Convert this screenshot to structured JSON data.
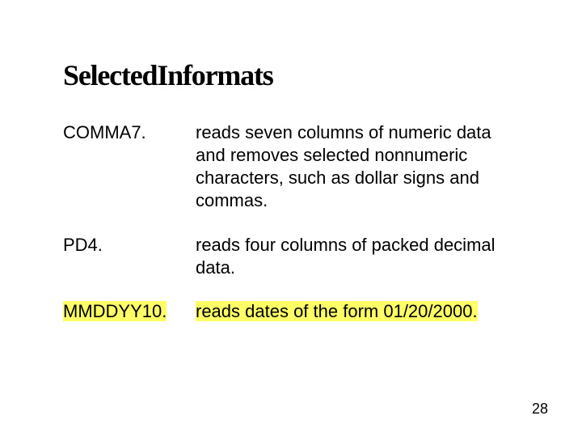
{
  "title_part1": "Selected",
  "title_part2": "Informats",
  "rows": [
    {
      "term": "COMMA7.",
      "desc": "reads seven columns of numeric data and removes selected nonnumeric characters, such as dollar signs and commas.",
      "highlight": false
    },
    {
      "term": "PD4.",
      "desc": "reads four columns of packed decimal data.",
      "highlight": false
    },
    {
      "term": "MMDDYY10.",
      "desc": "reads dates of the form 01/20/2000.",
      "highlight": true
    }
  ],
  "page_number": "28"
}
